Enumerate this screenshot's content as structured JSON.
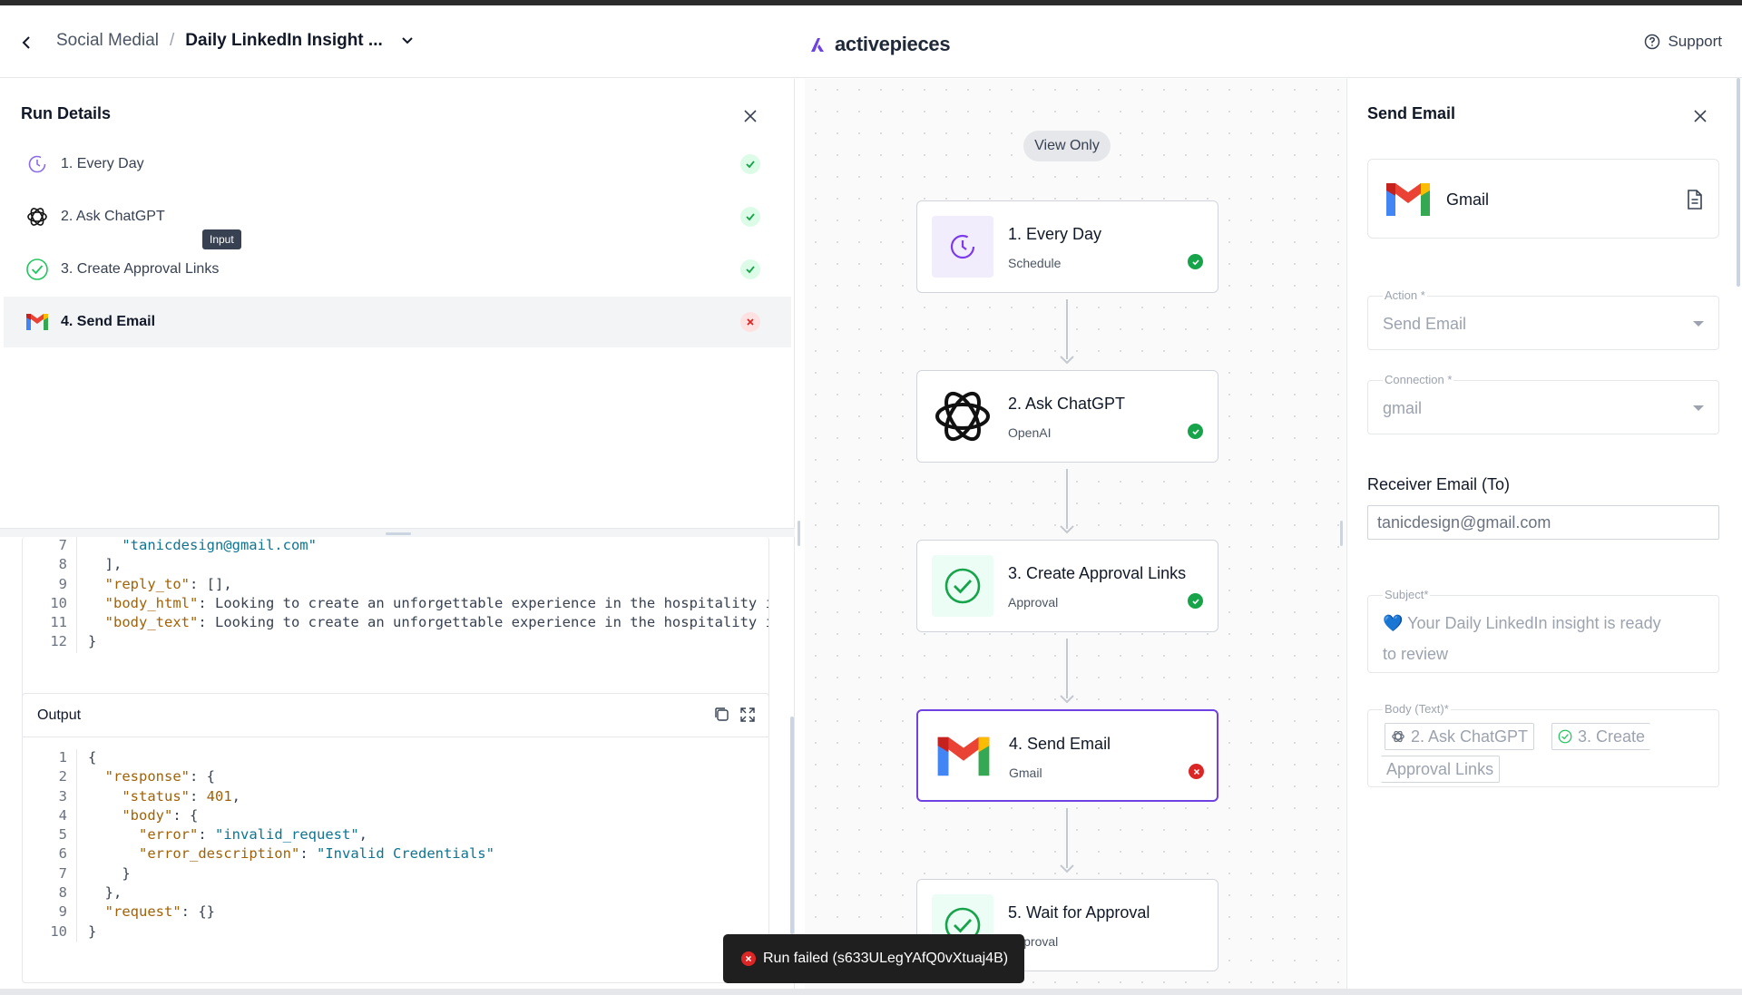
{
  "header": {
    "project": "Social Medial",
    "separator": "/",
    "flow_name": "Daily LinkedIn Insight ...",
    "brand": "activepieces",
    "support_label": "Support"
  },
  "run_details": {
    "title": "Run Details",
    "tooltip": "Input",
    "steps": [
      {
        "label": "1. Every Day",
        "status": "success",
        "icon": "clock-icon"
      },
      {
        "label": "2. Ask ChatGPT",
        "status": "success",
        "icon": "openai-icon"
      },
      {
        "label": "3. Create Approval Links",
        "status": "success",
        "icon": "check-circle-icon"
      },
      {
        "label": "4. Send Email",
        "status": "failed",
        "icon": "gmail-icon"
      }
    ],
    "input_code": [
      {
        "n": "7",
        "text": "    \"tanicdesign@gmail.com\""
      },
      {
        "n": "8",
        "text": "  ],"
      },
      {
        "n": "9",
        "text": "  \"reply_to\": [],"
      },
      {
        "n": "10",
        "text": "  \"body_html\": \"Looking to create an unforgettable experience in the hospitality i"
      },
      {
        "n": "11",
        "text": "  \"body_text\": \"Looking to create an unforgettable experience in the hospitality i"
      },
      {
        "n": "12",
        "text": "}"
      }
    ],
    "output_title": "Output",
    "output_code": [
      {
        "n": "1",
        "text": "{"
      },
      {
        "n": "2",
        "text": "  \"response\": {"
      },
      {
        "n": "3",
        "text": "    \"status\": 401,"
      },
      {
        "n": "4",
        "text": "    \"body\": {"
      },
      {
        "n": "5",
        "text": "      \"error\": \"invalid_request\","
      },
      {
        "n": "6",
        "text": "      \"error_description\": \"Invalid Credentials\""
      },
      {
        "n": "7",
        "text": "    }"
      },
      {
        "n": "8",
        "text": "  },"
      },
      {
        "n": "9",
        "text": "  \"request\": {}"
      },
      {
        "n": "10",
        "text": "}"
      }
    ]
  },
  "canvas": {
    "view_only": "View Only",
    "nodes": [
      {
        "title": "1. Every Day",
        "subtitle": "Schedule",
        "status": "success"
      },
      {
        "title": "2. Ask ChatGPT",
        "subtitle": "OpenAI",
        "status": "success"
      },
      {
        "title": "3. Create Approval Links",
        "subtitle": "Approval",
        "status": "success"
      },
      {
        "title": "4. Send Email",
        "subtitle": "Gmail",
        "status": "failed"
      },
      {
        "title": "5. Wait for Approval",
        "subtitle": "Approval",
        "status": "none"
      }
    ]
  },
  "step_settings": {
    "title": "Send Email",
    "piece_name": "Gmail",
    "action_label": "Action *",
    "action_value": "Send Email",
    "connection_label": "Connection *",
    "connection_value": "gmail",
    "receiver_label": "Receiver Email (To)",
    "receiver_value": "tanicdesign@gmail.com",
    "subject_label": "Subject*",
    "subject_value_line1": "💙 Your Daily LinkedIn insight is ready",
    "subject_value_line2": "to review",
    "body_label": "Body (Text)*",
    "body_chip_1": "2. Ask ChatGPT",
    "body_chip_2": "3. Create",
    "body_chip_3": "Approval Links"
  },
  "toast": {
    "message": "Run failed (s633ULegYAfQ0vXtuaj4B)"
  },
  "colors": {
    "accent": "#6e41e2",
    "success": "#16a34a",
    "error": "#dc2626"
  }
}
